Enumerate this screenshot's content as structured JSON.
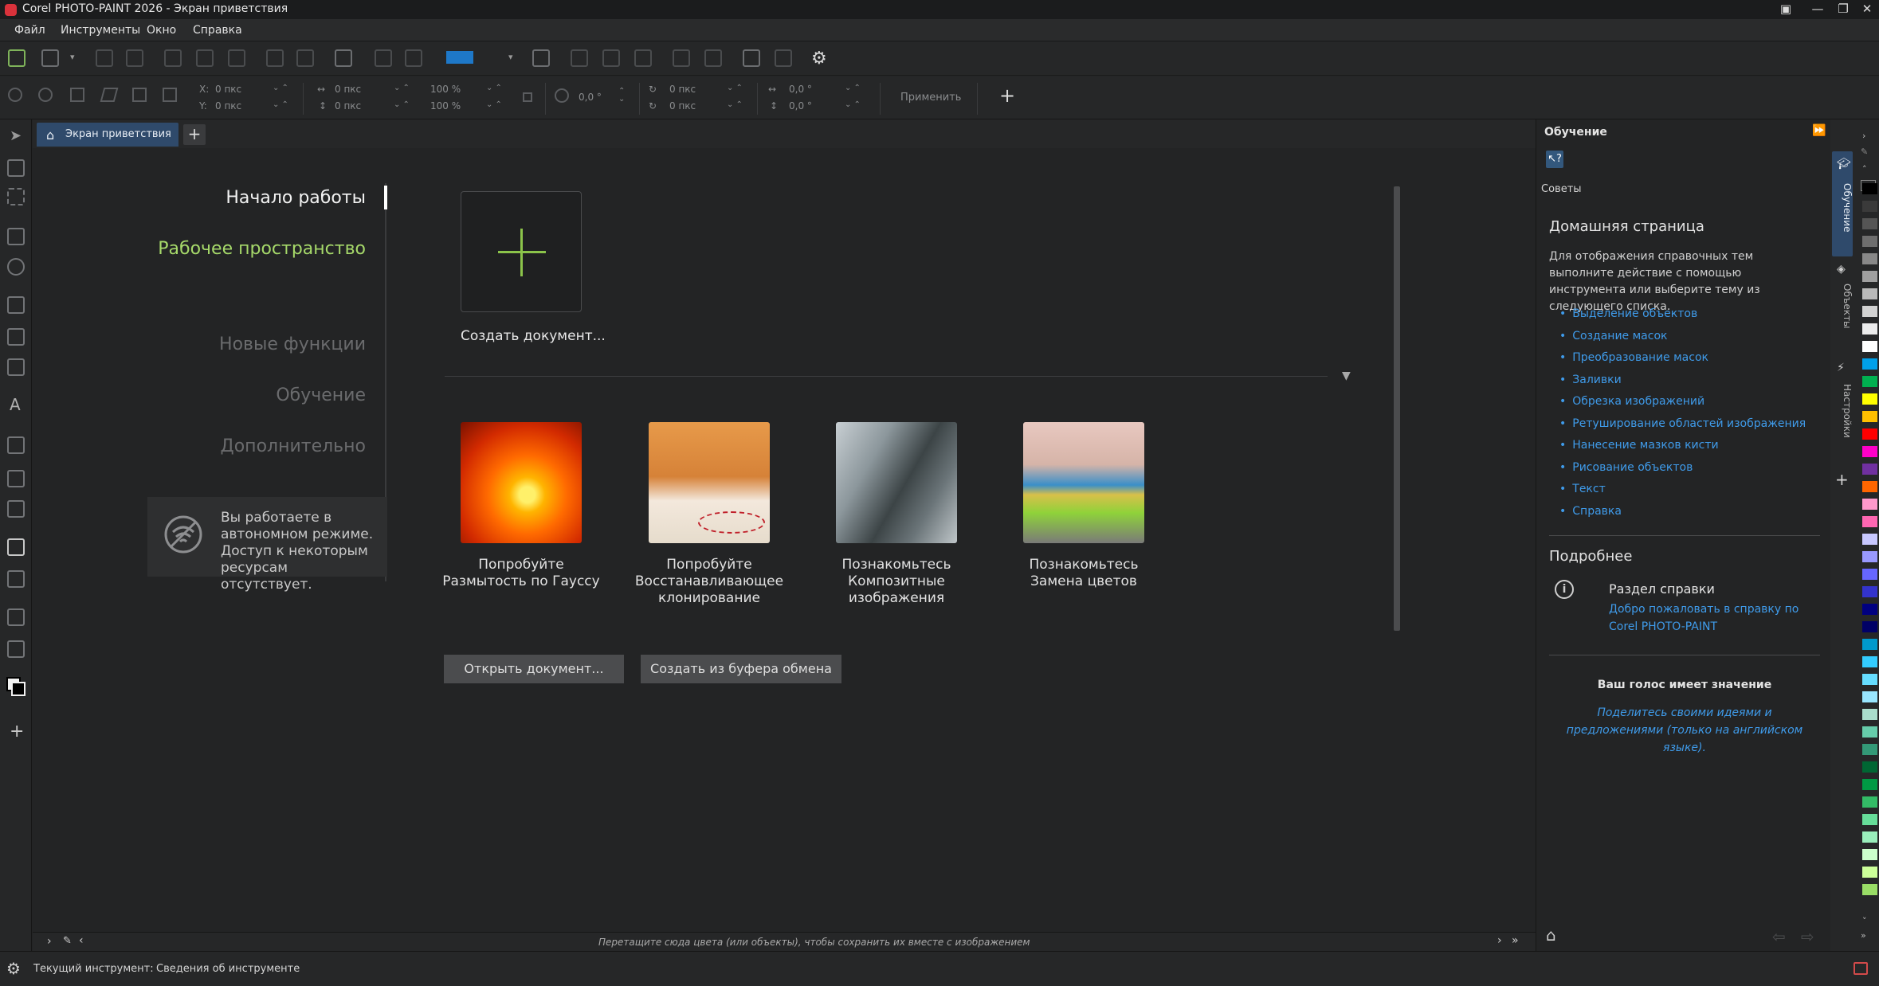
{
  "window": {
    "title": "Corel PHOTO-PAINT 2026 - Экран приветствия"
  },
  "menu": [
    "Файл",
    "Инструменты",
    "Окно",
    "Справка"
  ],
  "toolbar2": {
    "x_label": "X:",
    "x_value": "0 пкс",
    "y_label": "Y:",
    "y_value": "0 пкс",
    "w_value": "0 пкс",
    "h_value": "0 пкс",
    "scale_w": "100 %",
    "scale_h": "100 %",
    "rotate": "0,0 °",
    "cx_value": "0 пкс",
    "cy_value": "0 пкс",
    "skew_h": "0,0 °",
    "skew_v": "0,0 °",
    "apply": "Применить"
  },
  "tab": {
    "label": "Экран приветствия"
  },
  "nav": {
    "items": [
      "Начало работы",
      "Рабочее пространство",
      "Новые функции",
      "Обучение",
      "Дополнительно"
    ],
    "active": "Начало работы",
    "highlight": "Рабочее пространство"
  },
  "offline": {
    "text": "Вы работаете в автономном режиме. Доступ к некоторым ресурсам отсутствует."
  },
  "create_doc": {
    "label": "Создать документ..."
  },
  "cards": [
    {
      "caption": "Попробуйте Размытость по Гауссу"
    },
    {
      "caption": "Попробуйте Восстанавливающее клонирование"
    },
    {
      "caption": "Познакомьтесь Композитные изображения"
    },
    {
      "caption": "Познакомьтесь Замена цветов"
    }
  ],
  "buttons": {
    "open_doc": "Открыть документ...",
    "from_clipboard": "Создать из буфера обмена"
  },
  "learning_panel": {
    "title": "Обучение",
    "tips_label": "Советы",
    "home_heading": "Домашняя страница",
    "home_desc": "Для отображения справочных тем выполните действие с помощью инструмента или выберите тему из следующего списка.",
    "links": [
      "Выделение объектов",
      "Создание масок",
      "Преобразование масок",
      "Заливки",
      "Обрезка изображений",
      "Ретуширование областей изображения",
      "Нанесение мазков кисти",
      "Рисование объектов",
      "Текст",
      "Справка"
    ],
    "more_heading": "Подробнее",
    "help_title": "Раздел справки",
    "help_link": "Добро пожаловать в справку по Corel PHOTO-PAINT",
    "voice_heading": "Ваш голос имеет значение",
    "voice_link": "Поделитесь своими идеями и предложениями (только на английском языке)."
  },
  "side_tabs": [
    "Обучение",
    "Объекты",
    "Настройки"
  ],
  "colorbar": {
    "hint": "Перетащите сюда цвета (или объекты), чтобы сохранить их вместе с изображением"
  },
  "status": {
    "current_tool_label": "Текущий инструмент:",
    "tool_info": "Сведения об инструменте"
  },
  "colors": {
    "accent": "#1e78c8",
    "link": "#3f9bea",
    "highlight_green": "#a6d96a"
  },
  "palette": [
    "#000000",
    "#3a3a3a",
    "#555555",
    "#6e6e6e",
    "#888888",
    "#a0a0a0",
    "#b9b9b9",
    "#d2d2d2",
    "#ececec",
    "#ffffff",
    "#00a0e9",
    "#00b050",
    "#ffff00",
    "#ffc000",
    "#ff0000",
    "#ff00c8",
    "#7030a0",
    "#ff6600",
    "#ff99cc",
    "#ff66b2",
    "#c8c8ff",
    "#9999ff",
    "#6666ff",
    "#3333cc",
    "#000080",
    "#000066",
    "#0099cc",
    "#33ccff",
    "#66ddff",
    "#99e6ff",
    "#aaddcc",
    "#66ccaa",
    "#339977",
    "#006633",
    "#009944",
    "#33bb66",
    "#66dd99",
    "#99eebb",
    "#ccffcc",
    "#ccff99",
    "#99dd66"
  ]
}
